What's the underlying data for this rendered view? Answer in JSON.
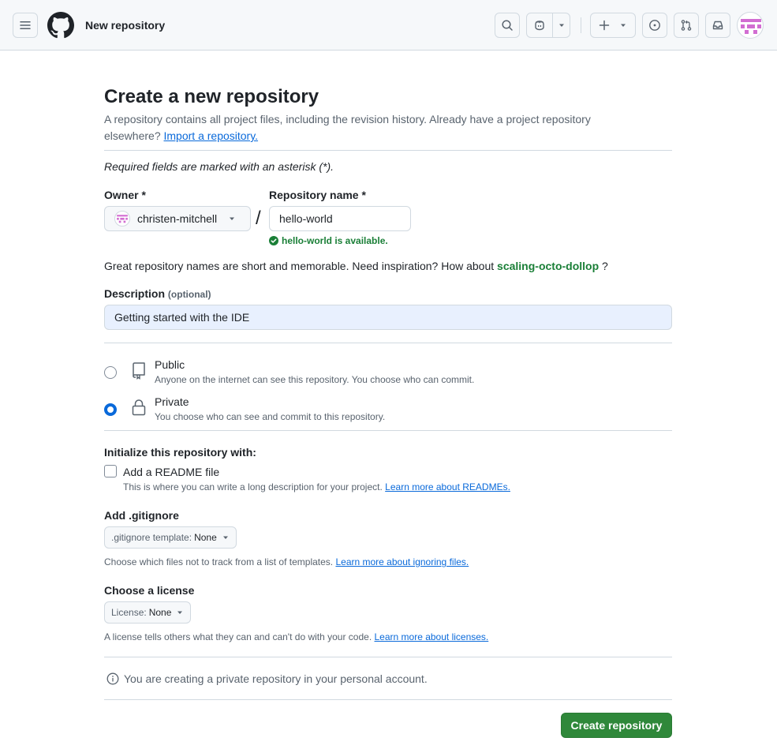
{
  "header": {
    "title": "New repository",
    "icons": [
      "menu-icon",
      "github-logo-icon",
      "search-icon",
      "copilot-icon",
      "chevron-down-icon",
      "plus-icon",
      "issues-icon",
      "pull-requests-icon",
      "inbox-icon",
      "avatar"
    ]
  },
  "page": {
    "title": "Create a new repository",
    "intro_text": "A repository contains all project files, including the revision history. Already have a project repository elsewhere?",
    "import_link": "Import a repository.",
    "required_note": "Required fields are marked with an asterisk (*)."
  },
  "owner": {
    "label": "Owner *",
    "value": "christen-mitchell"
  },
  "repo_name": {
    "label": "Repository name *",
    "value": "hello-world",
    "availability": "hello-world is available."
  },
  "inspiration": {
    "text": "Great repository names are short and memorable. Need inspiration? How about",
    "suggestion": "scaling-octo-dollop",
    "suffix": "?"
  },
  "description": {
    "label": "Description",
    "optional": "(optional)",
    "value": "Getting started with the IDE"
  },
  "visibility": {
    "selected": "private",
    "public": {
      "title": "Public",
      "sub": "Anyone on the internet can see this repository. You choose who can commit."
    },
    "private": {
      "title": "Private",
      "sub": "You choose who can see and commit to this repository."
    }
  },
  "initialize": {
    "heading": "Initialize this repository with:",
    "readme_label": "Add a README file",
    "readme_checked": false,
    "readme_note": "This is where you can write a long description for your project.",
    "readme_link": "Learn more about READMEs."
  },
  "gitignore": {
    "heading": "Add .gitignore",
    "prefix": ".gitignore template:",
    "value": "None",
    "note": "Choose which files not to track from a list of templates.",
    "link": "Learn more about ignoring files."
  },
  "license": {
    "heading": "Choose a license",
    "prefix": "License:",
    "value": "None",
    "note": "A license tells others what they can and can't do with your code.",
    "link": "Learn more about licenses."
  },
  "info": {
    "text": "You are creating a private repository in your personal account."
  },
  "submit": {
    "label": "Create repository"
  },
  "colors": {
    "accent": "#0969da",
    "success": "#1a7f37",
    "primary_button": "#2f883a",
    "avatar_pink": "#d26dd2"
  }
}
